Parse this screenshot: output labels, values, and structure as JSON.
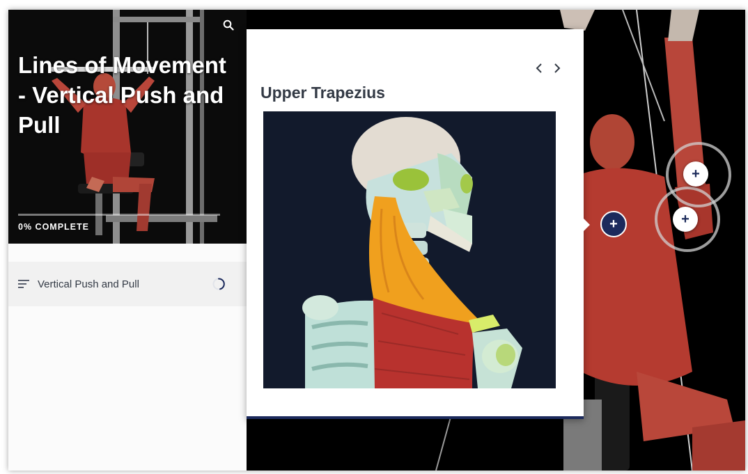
{
  "course": {
    "title": "Lines of Movement - Vertical Push and Pull",
    "progress_label": "0% COMPLETE",
    "progress_percent": 0
  },
  "sidebar": {
    "lessons": [
      {
        "label": "Vertical Push and Pull",
        "status": "in-progress"
      }
    ]
  },
  "popup": {
    "title": "Upper Trapezius",
    "prev_icon": "chevron-left-icon",
    "next_icon": "chevron-right-icon"
  },
  "icons": {
    "search": "search-icon",
    "menu": "hamburger-icon",
    "hotspot": "plus-icon"
  },
  "hotspots": [
    {
      "symbol": "+",
      "state": "default"
    },
    {
      "symbol": "+",
      "state": "default"
    },
    {
      "symbol": "+",
      "state": "active"
    }
  ],
  "colors": {
    "accent_navy": "#1c2a5c",
    "header_bg": "#0b0b0b",
    "text_dark": "#333a45",
    "trapezius_highlight": "#f0a01e",
    "muscle_red": "#b8322e"
  }
}
